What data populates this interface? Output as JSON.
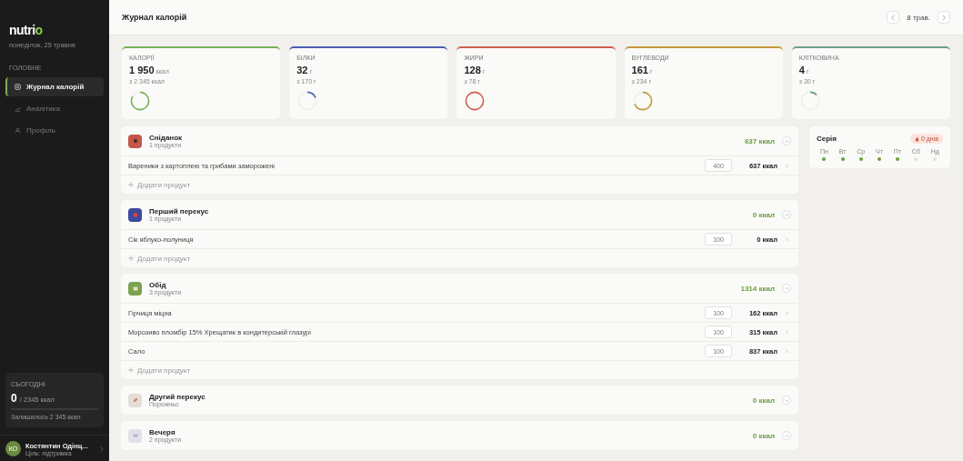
{
  "sidebar": {
    "logo": {
      "text": "nutri",
      "accent": "o"
    },
    "date": "понеділок, 25 травня",
    "section": "ГОЛОВНЕ",
    "items": [
      {
        "label": "Журнал калорій",
        "selected": true
      },
      {
        "label": "Аналітика",
        "selected": false
      },
      {
        "label": "Профіль",
        "selected": false
      }
    ],
    "today": {
      "title": "СЬОГОДНІ",
      "value": "0",
      "goal": "/ 2345 ккал",
      "remaining": "Залишилось 2 345 ккал"
    },
    "user": {
      "initials": "КО",
      "name": "Костянтин Одінц...",
      "subtitle": "Ціль: підтримка"
    }
  },
  "header": {
    "title": "Журнал калорій",
    "date": "8 трав."
  },
  "stats": [
    {
      "label": "КАЛОРІЇ",
      "value": "1 950",
      "unit": "ккал",
      "goal": "з 2 345 ккал",
      "color": "#7cb059"
    },
    {
      "label": "БІЛКИ",
      "value": "32",
      "unit": "г",
      "goal": "з 170 г",
      "color": "#4a5fb0"
    },
    {
      "label": "ЖИРИ",
      "value": "128",
      "unit": "г",
      "goal": "з 78 г",
      "color": "#d0604f"
    },
    {
      "label": "ВУГЛЕВОДИ",
      "value": "161",
      "unit": "г",
      "goal": "з 234 г",
      "color": "#c39a3c"
    },
    {
      "label": "КЛІТКОВИНА",
      "value": "4",
      "unit": "г",
      "goal": "з 30 г",
      "color": "#6c9c8c"
    }
  ],
  "meals": [
    {
      "title": "Сніданок",
      "subtitle": "1 продукти",
      "kcal": "637 ккал",
      "color": "#c4574a",
      "expanded": true,
      "items": [
        {
          "name": "Вареники з картоплею та грибами заморожені",
          "amount": "400",
          "kcal": "637 ккал"
        }
      ],
      "add": "Додати продукт"
    },
    {
      "title": "Перший перекус",
      "subtitle": "1 продукти",
      "kcal": "0 ккал",
      "color": "#3b4aa0",
      "expanded": true,
      "items": [
        {
          "name": "Сік яблуко-полуниця",
          "amount": "100",
          "kcal": "0 ккал"
        }
      ],
      "add": "Додати продукт"
    },
    {
      "title": "Обід",
      "subtitle": "3 продукти",
      "kcal": "1314 ккал",
      "color": "#7ba24f",
      "expanded": true,
      "items": [
        {
          "name": "Гірчиця міцна",
          "amount": "100",
          "kcal": "162 ккал"
        },
        {
          "name": "Морозиво пломбір 15% Хрещатик в кондитерській глазурі",
          "amount": "100",
          "kcal": "315 ккал"
        },
        {
          "name": "Сало",
          "amount": "100",
          "kcal": "837 ккал"
        }
      ],
      "add": "Додати продукт"
    },
    {
      "title": "Другий перекус",
      "subtitle": "Порожньо",
      "kcal": "0 ккал",
      "color": "#e6ddd6",
      "expanded": false
    },
    {
      "title": "Вечеря",
      "subtitle": "2 продукти",
      "kcal": "0 ккал",
      "color": "#e3e0ea",
      "expanded": true
    }
  ],
  "streak": {
    "title": "Серія",
    "badge": "0 днів",
    "days": [
      {
        "label": "Пн",
        "done": true
      },
      {
        "label": "Вт",
        "done": true
      },
      {
        "label": "Ср",
        "done": true
      },
      {
        "label": "Чт",
        "done": true
      },
      {
        "label": "Пт",
        "done": true
      },
      {
        "label": "Сб",
        "done": false
      },
      {
        "label": "Нд",
        "done": false
      }
    ]
  }
}
